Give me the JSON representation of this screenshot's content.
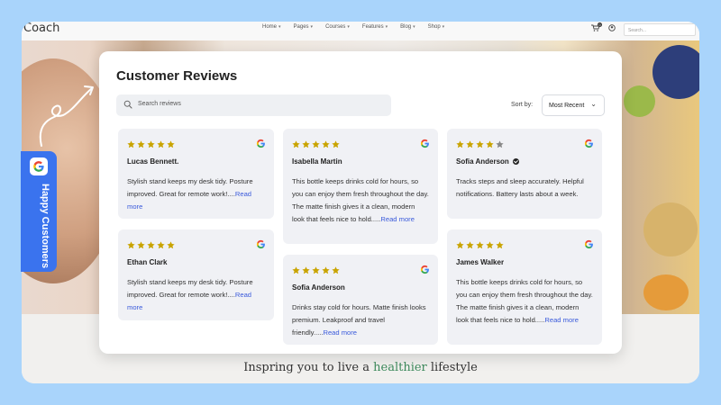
{
  "site": {
    "logo": "Coach",
    "nav": [
      "Home",
      "Pages",
      "Courses",
      "Features",
      "Blog",
      "Shop"
    ],
    "cart_count": "0",
    "search_placeholder": "Search..."
  },
  "tagline": {
    "prefix": "Inspring you to live a ",
    "highlight": "healthier",
    "suffix": " lifestyle"
  },
  "badge": {
    "label": "Happy Customers"
  },
  "modal": {
    "title": "Customer Reviews",
    "search_placeholder": "Search reviews",
    "sort_label": "Sort by:",
    "sort_value": "Most Recent"
  },
  "colors": {
    "accent": "#3a73ee",
    "star": "#c9a400",
    "star_empty": "#888888",
    "link": "#3b5bdb"
  },
  "reviews": [
    {
      "name": "Lucas Bennett.",
      "rating": 5,
      "verified": false,
      "text": "Stylish stand keeps my desk tidy. Posture improved. Great for remote work!....",
      "more": "Read more"
    },
    {
      "name": "Ethan Clark",
      "rating": 5,
      "verified": false,
      "text": "Stylish stand keeps my desk tidy. Posture improved. Great for remote work!....",
      "more": "Read more"
    },
    {
      "name": "Isabella Martin",
      "rating": 5,
      "verified": false,
      "text": "This bottle keeps drinks cold for hours, so you can enjoy them fresh throughout the day. The matte finish gives it a clean, modern look that feels nice to hold.....",
      "more": "Read more"
    },
    {
      "name": "Sofia Anderson",
      "rating": 5,
      "verified": false,
      "text": "Drinks stay cold for hours. Matte finish looks premium. Leakproof and travel friendly.....",
      "more": "Read more"
    },
    {
      "name": "Sofia Anderson",
      "rating": 4,
      "verified": true,
      "text": "Tracks steps and sleep accurately. Helpful notifications. Battery lasts about a week.",
      "more": ""
    },
    {
      "name": "James Walker",
      "rating": 5,
      "verified": false,
      "text": "This bottle keeps drinks cold for hours, so you can enjoy them fresh throughout the day. The matte finish gives it a clean, modern look that feels nice to hold.....",
      "more": "Read more"
    }
  ]
}
